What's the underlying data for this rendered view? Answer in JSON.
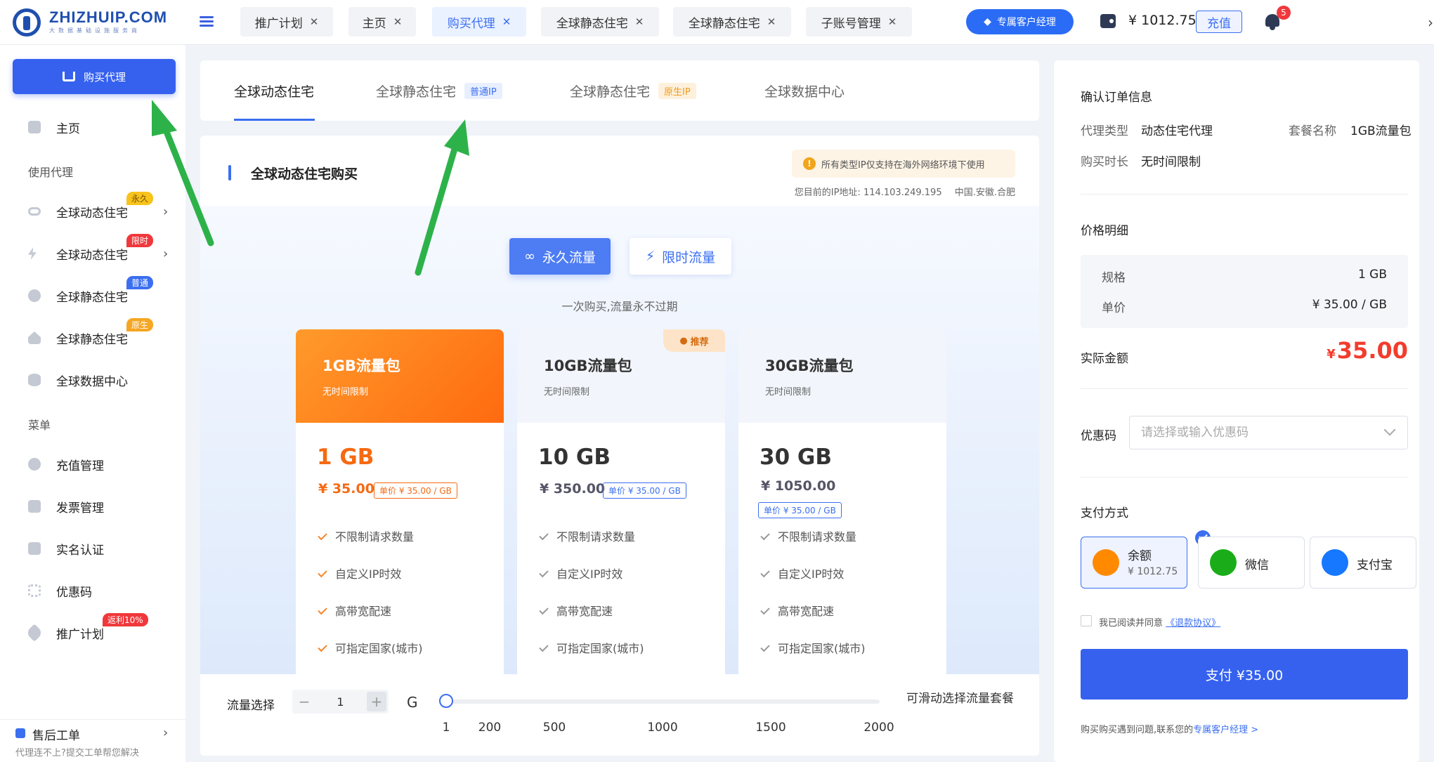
{
  "brand": {
    "name": "ZHIZHUIP.COM",
    "tagline": "大数据基础设施服务商"
  },
  "tabs": [
    {
      "label": "推广计划",
      "active": false
    },
    {
      "label": "主页",
      "active": false
    },
    {
      "label": "购买代理",
      "active": true
    },
    {
      "label": "全球静态住宅",
      "active": false
    },
    {
      "label": "全球静态住宅",
      "active": false
    },
    {
      "label": "子账号管理",
      "active": false
    }
  ],
  "header": {
    "manager_button": "专属客户经理",
    "balance": "¥ 1012.75",
    "recharge": "充值",
    "notifications": "5"
  },
  "sidebar": {
    "buy_button": "购买代理",
    "home": "主页",
    "section_use": "使用代理",
    "section_menu": "菜单",
    "proxy_items": [
      {
        "label": "全球动态住宅",
        "badge": "永久",
        "badge_color": "#f7c31c",
        "icon": "infinity-icon"
      },
      {
        "label": "全球动态住宅",
        "badge": "限时",
        "badge_color": "#f0383c",
        "icon": "bolt-icon"
      },
      {
        "label": "全球静态住宅",
        "badge": "普通",
        "badge_color": "#3b6ff0",
        "icon": "ip-icon"
      },
      {
        "label": "全球静态住宅",
        "badge": "原生",
        "badge_color": "#f5a623",
        "icon": "house-icon"
      },
      {
        "label": "全球数据中心",
        "badge": "",
        "icon": "database-icon"
      }
    ],
    "menu_items": [
      {
        "label": "充值管理",
        "icon": "yen-icon"
      },
      {
        "label": "发票管理",
        "icon": "invoice-icon"
      },
      {
        "label": "实名认证",
        "icon": "id-card-icon"
      },
      {
        "label": "优惠码",
        "icon": "coupon-icon"
      },
      {
        "label": "推广计划",
        "icon": "heart-icon",
        "badge": "返利10%"
      }
    ],
    "ticket": {
      "label": "售后工单",
      "sub": "代理连不上?提交工单帮您解决"
    }
  },
  "product_tabs": [
    {
      "label": "全球动态住宅",
      "tag": ""
    },
    {
      "label": "全球静态住宅",
      "tag": "普通IP"
    },
    {
      "label": "全球静态住宅",
      "tag": "原生IP"
    },
    {
      "label": "全球数据中心",
      "tag": ""
    }
  ],
  "main": {
    "title": "全球动态住宅购买",
    "notice": "所有类型IP仅支持在海外网络环境下使用",
    "ip_label": "您目前的IP地址:",
    "ip": "114.103.249.195",
    "location": "中国.安徽.合肥",
    "traffic_buttons": [
      "永久流量",
      "限时流量"
    ],
    "traffic_hint": "一次购买,流量永不过期",
    "recommend_badge": "推荐",
    "features": [
      "不限制请求数量",
      "自定义IP时效",
      "高带宽配速",
      "可指定国家(城市)"
    ],
    "packages": [
      {
        "name": "1GB流量包",
        "validity": "无时间限制",
        "size": "1 GB",
        "price": "¥ 35.00",
        "unit_price": "单价 ¥ 35.00 / GB",
        "selected": true
      },
      {
        "name": "10GB流量包",
        "validity": "无时间限制",
        "size": "10 GB",
        "price": "¥ 350.00",
        "unit_price": "单价 ¥ 35.00 / GB",
        "selected": false
      },
      {
        "name": "30GB流量包",
        "validity": "无时间限制",
        "size": "30 GB",
        "price": "¥ 1050.00",
        "unit_price": "单价 ¥ 35.00 / GB",
        "selected": false
      }
    ],
    "slider": {
      "label": "流量选择",
      "value": "1",
      "unit": "G",
      "ticks": [
        "1",
        "200",
        "500",
        "1000",
        "1500",
        "2000"
      ],
      "hint": "可滑动选择流量套餐",
      "min": 1,
      "max": 2000,
      "current": 1
    }
  },
  "order": {
    "title": "确认订单信息",
    "proxy_type_label": "代理类型",
    "proxy_type": "动态住宅代理",
    "package_label": "套餐名称",
    "package": "1GB流量包",
    "duration_label": "购买时长",
    "duration": "无时间限制",
    "price_title": "价格明细",
    "spec_label": "规格",
    "spec": "1 GB",
    "unit_label": "单价",
    "unit": "¥ 35.00 / GB",
    "total_label": "实际金额",
    "total_symbol": "¥",
    "total": "35.00",
    "coupon_label": "优惠码",
    "coupon_placeholder": "请选择或输入优惠码",
    "pay_title": "支付方式",
    "pay_methods": [
      {
        "name": "余额",
        "sub": "¥ 1012.75",
        "color": "#ff8a00",
        "icon": "wallet-icon"
      },
      {
        "name": "微信",
        "sub": "",
        "color": "#1aad19",
        "icon": "wechat-icon"
      },
      {
        "name": "支付宝",
        "sub": "",
        "color": "#1677ff",
        "icon": "alipay-icon"
      }
    ],
    "agree_text": "我已阅读并同意",
    "agree_link": "《退款协议》",
    "pay_button": "支付 ¥35.00",
    "help_text": "购买购买遇到问题,联系您的",
    "help_link": "专属客户经理 >"
  }
}
